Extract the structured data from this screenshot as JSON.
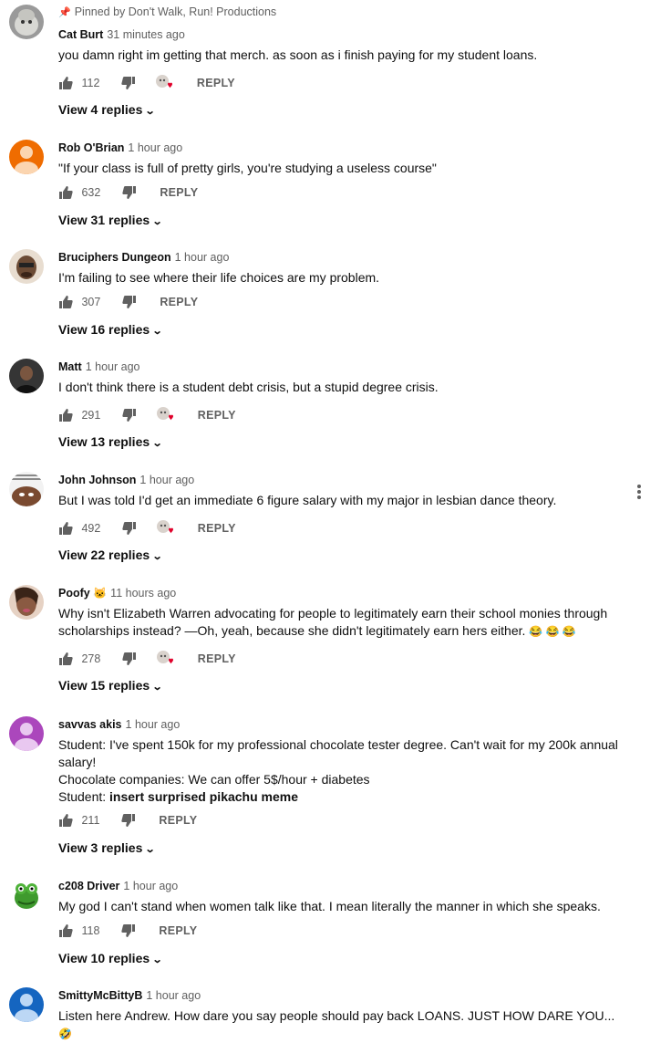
{
  "pinned_label": "Pinned by Don't Walk, Run! Productions",
  "reply_label": "REPLY",
  "comments": [
    {
      "author": "Cat Burt",
      "time": "31 minutes ago",
      "text": "you damn right im getting that merch. as soon as i finish paying for my student loans.",
      "likes": "112",
      "hearted": true,
      "replies": "View 4 replies"
    },
    {
      "author": "Rob O'Brian",
      "time": "1 hour ago",
      "text": "\"If your class is full of pretty girls, you're studying a useless course\"",
      "likes": "632",
      "hearted": false,
      "replies": "View 31 replies"
    },
    {
      "author": "Bruciphers Dungeon",
      "time": "1 hour ago",
      "text": "I'm failing to see where their life choices are my problem.",
      "likes": "307",
      "hearted": false,
      "replies": "View 16 replies"
    },
    {
      "author": "Matt",
      "time": "1 hour ago",
      "text": "I don't think there is a student debt crisis, but a stupid degree crisis.",
      "likes": "291",
      "hearted": true,
      "replies": "View 13 replies"
    },
    {
      "author": "John Johnson",
      "time": "1 hour ago",
      "text": "But I was told I'd get an immediate 6 figure salary with my major in lesbian dance theory.",
      "likes": "492",
      "hearted": true,
      "replies": "View 22 replies"
    },
    {
      "author": "Poofy",
      "author_badge": "🐱",
      "time": "11 hours ago",
      "text": "Why isn't Elizabeth Warren advocating for people to legitimately earn their school monies through scholarships instead? —Oh, yeah, because she didn't legitimately earn hers either.",
      "text_emoji": "😂 😂 😂",
      "likes": "278",
      "hearted": true,
      "replies": "View 15 replies"
    },
    {
      "author": "savvas akis",
      "time": "1 hour ago",
      "text_lines": [
        "Student: I've spent 150k for my professional chocolate tester degree. Can't wait for my 200k annual salary!",
        "Chocolate companies: We can offer 5$/hour + diabetes"
      ],
      "text_prefix": "Student: ",
      "text_bold": "insert surprised pikachu meme",
      "likes": "211",
      "hearted": false,
      "replies": "View 3 replies"
    },
    {
      "author": "c208 Driver",
      "time": "1 hour ago",
      "text": "My god I can't stand when women talk like that. I mean literally the manner in which she speaks.",
      "likes": "118",
      "hearted": false,
      "replies": "View 10 replies"
    },
    {
      "author": "SmittyMcBittyB",
      "time": "1 hour ago",
      "text": "Listen here Andrew. How dare you say people should pay back LOANS. JUST HOW DARE YOU...",
      "text_emoji": "🤣"
    }
  ],
  "colors": {
    "text": "#0f0f0f",
    "meta": "#606060",
    "heart": "#e0002a",
    "avatar_orange": "#ef6c00",
    "avatar_purple": "#ab47bc",
    "avatar_blue": "#1565c0"
  }
}
